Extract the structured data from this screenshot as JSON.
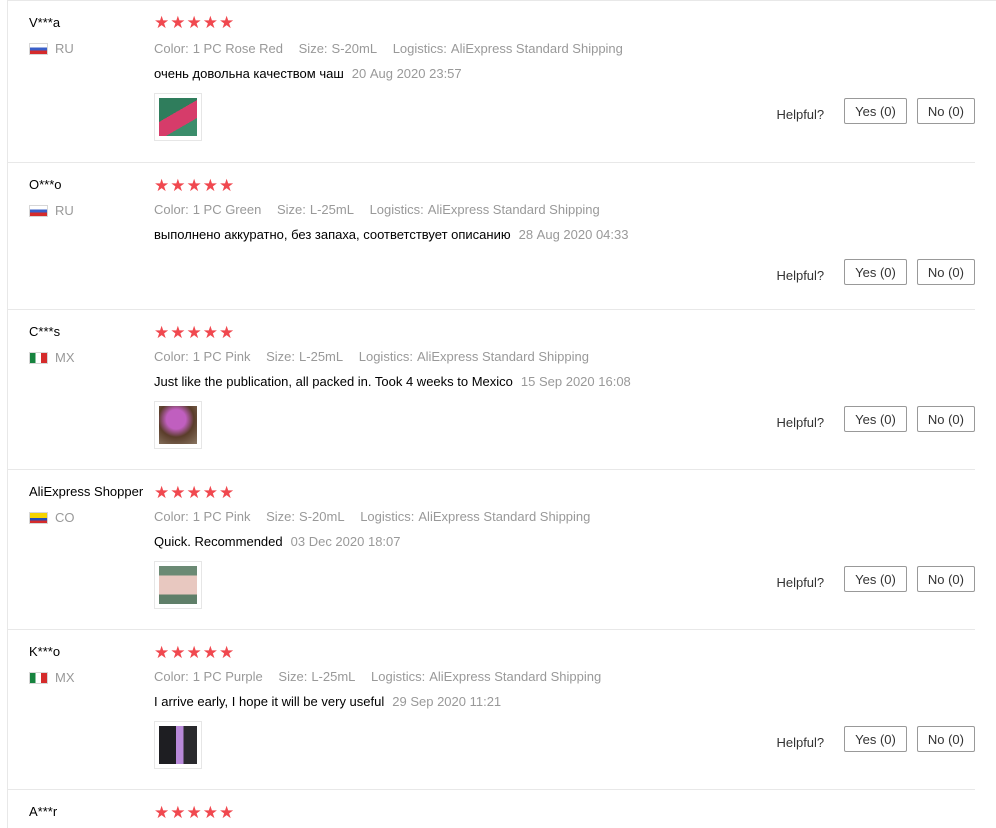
{
  "labels": {
    "color": "Color:",
    "size": "Size:",
    "logistics": "Logistics:",
    "helpful": "Helpful?"
  },
  "star_icon": "★",
  "reviews": [
    {
      "name": "V***a",
      "country": "RU",
      "rating": 5,
      "color": "1 PC Rose Red",
      "size": "S-20mL",
      "logistics": "AliExpress Standard Shipping",
      "text": "очень довольна качеством чаш",
      "date": "20 Aug 2020 23:57",
      "has_photo": true,
      "photo_colors": [
        "#2f7d5c",
        "#d63c6a"
      ],
      "yes": "Yes (0)",
      "no": "No (0)"
    },
    {
      "name": "O***o",
      "country": "RU",
      "rating": 5,
      "color": "1 PC Green",
      "size": "L-25mL",
      "logistics": "AliExpress Standard Shipping",
      "text": "выполнено аккуратно, без запаха, соответствует описанию",
      "date": "28 Aug 2020 04:33",
      "has_photo": false,
      "yes": "Yes (0)",
      "no": "No (0)"
    },
    {
      "name": "C***s",
      "country": "MX",
      "rating": 5,
      "color": "1 PC Pink",
      "size": "L-25mL",
      "logistics": "AliExpress Standard Shipping",
      "text": "Just like the publication, all packed in. Took 4 weeks to Mexico",
      "date": "15 Sep 2020 16:08",
      "has_photo": true,
      "photo_colors": [
        "#5a3d2a",
        "#b64fb0"
      ],
      "yes": "Yes (0)",
      "no": "No (0)"
    },
    {
      "name": "AliExpress Shopper",
      "country": "CO",
      "rating": 5,
      "color": "1 PC Pink",
      "size": "S-20mL",
      "logistics": "AliExpress Standard Shipping",
      "text": "Quick. Recommended",
      "date": "03 Dec 2020 18:07",
      "has_photo": true,
      "photo_colors": [
        "#6b8a74",
        "#e8c8c0"
      ],
      "yes": "Yes (0)",
      "no": "No (0)"
    },
    {
      "name": "K***o",
      "country": "MX",
      "rating": 5,
      "color": "1 PC Purple",
      "size": "L-25mL",
      "logistics": "AliExpress Standard Shipping",
      "text": "I arrive early, I hope it will be very useful",
      "date": "29 Sep 2020 11:21",
      "has_photo": true,
      "photo_colors": [
        "#1e1e22",
        "#b889d9"
      ],
      "yes": "Yes (0)",
      "no": "No (0)"
    },
    {
      "name": "A***r",
      "country": "",
      "rating": 5,
      "partial": true
    }
  ]
}
